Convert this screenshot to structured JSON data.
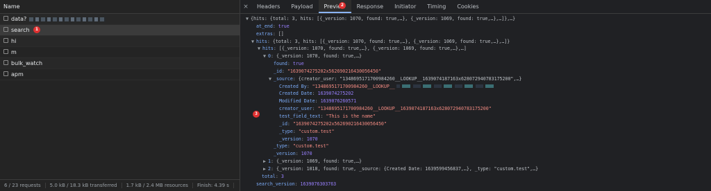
{
  "left": {
    "header": "Name",
    "requests": [
      {
        "name": "data?",
        "state": "alt"
      },
      {
        "name": "search",
        "state": "selected"
      },
      {
        "name": "hi",
        "state": "alt"
      },
      {
        "name": "m",
        "state": ""
      },
      {
        "name": "bulk_watch",
        "state": "alt"
      },
      {
        "name": "apm",
        "state": ""
      }
    ],
    "status": {
      "requests": "6 / 23 requests",
      "transferred": "5.0 kB / 18.3 kB transferred",
      "resources": "1.7 kB / 2.4 MB resources",
      "finish": "Finish: 4.39 s"
    }
  },
  "badges": {
    "one": "1",
    "two": "2",
    "three": "3"
  },
  "tabs": {
    "close": "×",
    "items": [
      "Headers",
      "Payload",
      "Preview",
      "Response",
      "Initiator",
      "Timing",
      "Cookies"
    ],
    "active": "Preview"
  },
  "preview": {
    "l0": {
      "tri": "▼",
      "text": "{hits: {total: 3, hits: [{_version: 1070, found: true,…}, {_version: 1069, found: true,…},…]},…}"
    },
    "l1": {
      "key": "at_end",
      "val": "true"
    },
    "l2": {
      "key": "extras",
      "val": "[]"
    },
    "l3": {
      "tri": "▼",
      "key": "hits",
      "text": "{total: 3, hits: [{_version: 1070, found: true,…}, {_version: 1069, found: true,…},…]}"
    },
    "l4": {
      "tri": "▼",
      "key": "hits",
      "text": "[{_version: 1070, found: true,…}, {_version: 1069, found: true,…},…]"
    },
    "l5": {
      "tri": "▼",
      "key": "0",
      "text": "{_version: 1070, found: true,…}"
    },
    "l6": {
      "key": "found",
      "val": "true"
    },
    "l7": {
      "key": "_id",
      "val": "\"1639074275202x562690216430056450\""
    },
    "l8": {
      "tri": "▼",
      "key": "_source",
      "text": "{creator_user: \"1348695171700984260__LOOKUP__1639074187163x628072940783175200\",…}"
    },
    "l9": {
      "key": "Created By",
      "val": "\"1348695171700984260__LOOKUP__"
    },
    "l10": {
      "key": "Created Date",
      "val": "1639074275202"
    },
    "l11": {
      "key": "Modified Date",
      "val": "1639076260571"
    },
    "l12": {
      "key": "creator_user",
      "val": "\"1348695171700984260__LOOKUP__1639074187163x628072940783175200\""
    },
    "l13": {
      "key": "test_field_text",
      "val": "\"This is the name\""
    },
    "l14": {
      "key": "_id",
      "val": "\"1639074275202x562690216430056450\""
    },
    "l15": {
      "key": "_type",
      "val": "\"custom.test\""
    },
    "l16": {
      "key": "_version",
      "val": "1070"
    },
    "l17": {
      "key": "_type",
      "val": "\"custom.test\""
    },
    "l18": {
      "key": "_version",
      "val": "1070"
    },
    "l19": {
      "tri": "▶",
      "key": "1",
      "text": "{_version: 1069, found: true,…}"
    },
    "l20": {
      "tri": "▶",
      "key": "2",
      "text": "{_version: 1018, found: true, _source: {Created Date: 1639599456837,…}, _type: \"custom.test\",…}"
    },
    "l21": {
      "key": "total",
      "val": "3"
    },
    "l22": {
      "key": "search_version",
      "val": "1639076303763"
    }
  }
}
